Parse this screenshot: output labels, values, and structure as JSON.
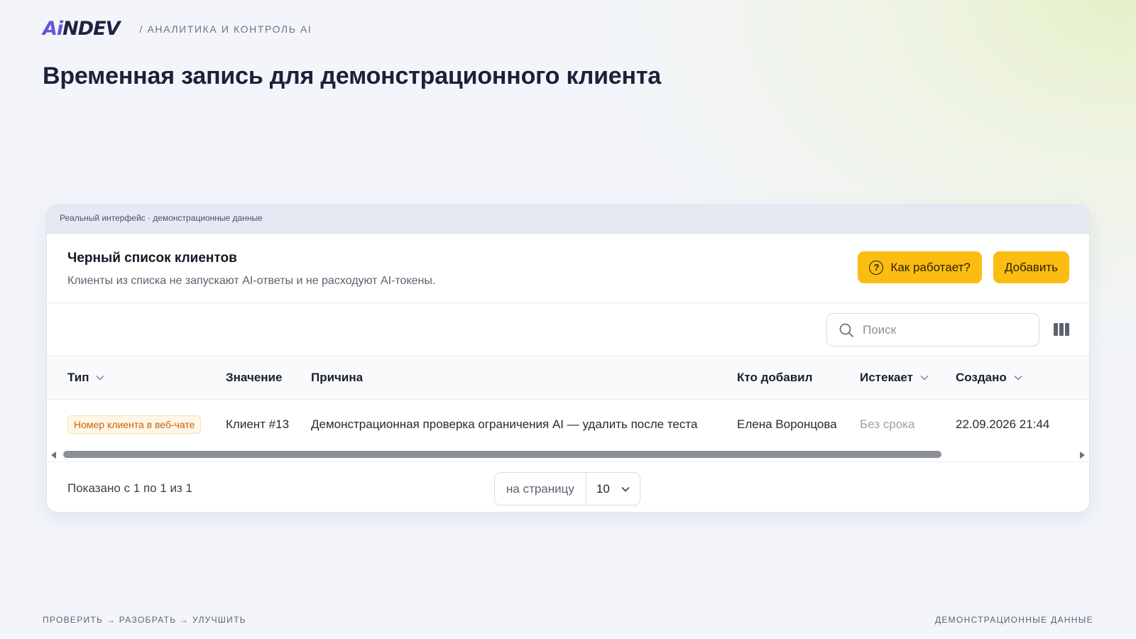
{
  "brand": {
    "logo_ai": "Ai",
    "logo_rest": "NDEV",
    "section": "/ АНАЛИТИКА И КОНТРОЛЬ AI"
  },
  "page": {
    "title": "Временная запись для демонстрационного клиента"
  },
  "frame": {
    "caption": "Реальный интерфейс · демонстрационные данные"
  },
  "panel": {
    "title": "Черный список клиентов",
    "subtitle": "Клиенты из списка не запускают AI-ответы и не расходуют AI-токены.",
    "help_button": "Как работает?",
    "help_icon": "question-circle-icon",
    "add_button": "Добавить"
  },
  "search": {
    "placeholder": "Поиск",
    "value": ""
  },
  "table": {
    "columns": {
      "type": "Тип",
      "value": "Значение",
      "reason": "Причина",
      "added_by": "Кто добавил",
      "expires": "Истекает",
      "created": "Создано"
    },
    "rows": [
      {
        "type": "Номер клиента в веб-чате",
        "value": "Клиент #13",
        "reason": "Демонстрационная проверка ограничения AI — удалить после теста",
        "added_by": "Елена Воронцова",
        "expires": "Без срока",
        "created": "22.09.2026 21:44"
      }
    ]
  },
  "footer": {
    "shown": "Показано с 1 по 1 из 1",
    "per_page_label": "на страницу",
    "per_page_value": "10"
  },
  "page_footer": {
    "left": "ПРОВЕРИТЬ → РАЗОБРАТЬ → УЛУЧШИТЬ",
    "right": "ДЕМОНСТРАЦИОННЫЕ ДАННЫЕ"
  },
  "colors": {
    "accent": "#fbbd12",
    "logo_ai": "#6157d8",
    "logo_text": "#1d2440",
    "badge_text": "#c2650f"
  }
}
